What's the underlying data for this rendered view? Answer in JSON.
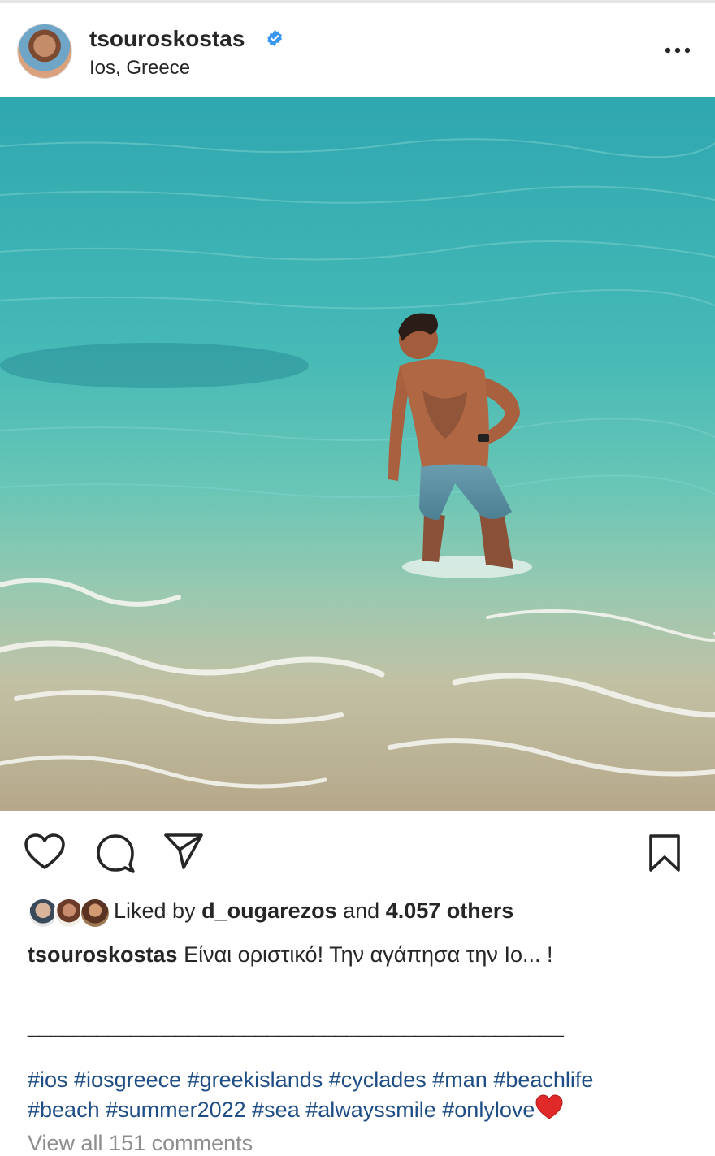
{
  "post": {
    "username": "tsouroskostas",
    "location": "Ios, Greece"
  },
  "likes": {
    "prefix": "Liked by ",
    "liker": "d_ougarezos",
    "middle": " and ",
    "count_text": "4.057 others"
  },
  "caption": {
    "username": "tsouroskostas",
    "text": " Είναι οριστικό! Την αγάπησα την Ιο... !",
    "divider": "_______________________________________________"
  },
  "hashtags": {
    "line1": "#ios #iosgreece #greekislands #cyclades #man #beachlife",
    "line2": "#beach #summer2022 #sea #alwayssmile #onlylove"
  },
  "comments": {
    "view_all": "View all 151 comments"
  },
  "icons": {
    "verified": "verified-badge-icon",
    "more": "more-options-icon",
    "like": "heart-icon",
    "comment": "comment-bubble-icon",
    "share": "paper-plane-icon",
    "save": "bookmark-icon",
    "emoji": "red-heart-emoji"
  },
  "colors": {
    "text": "#262626",
    "hashtag": "#1f4d85",
    "verified": "#3897f0",
    "muted": "#8e8e8e"
  }
}
